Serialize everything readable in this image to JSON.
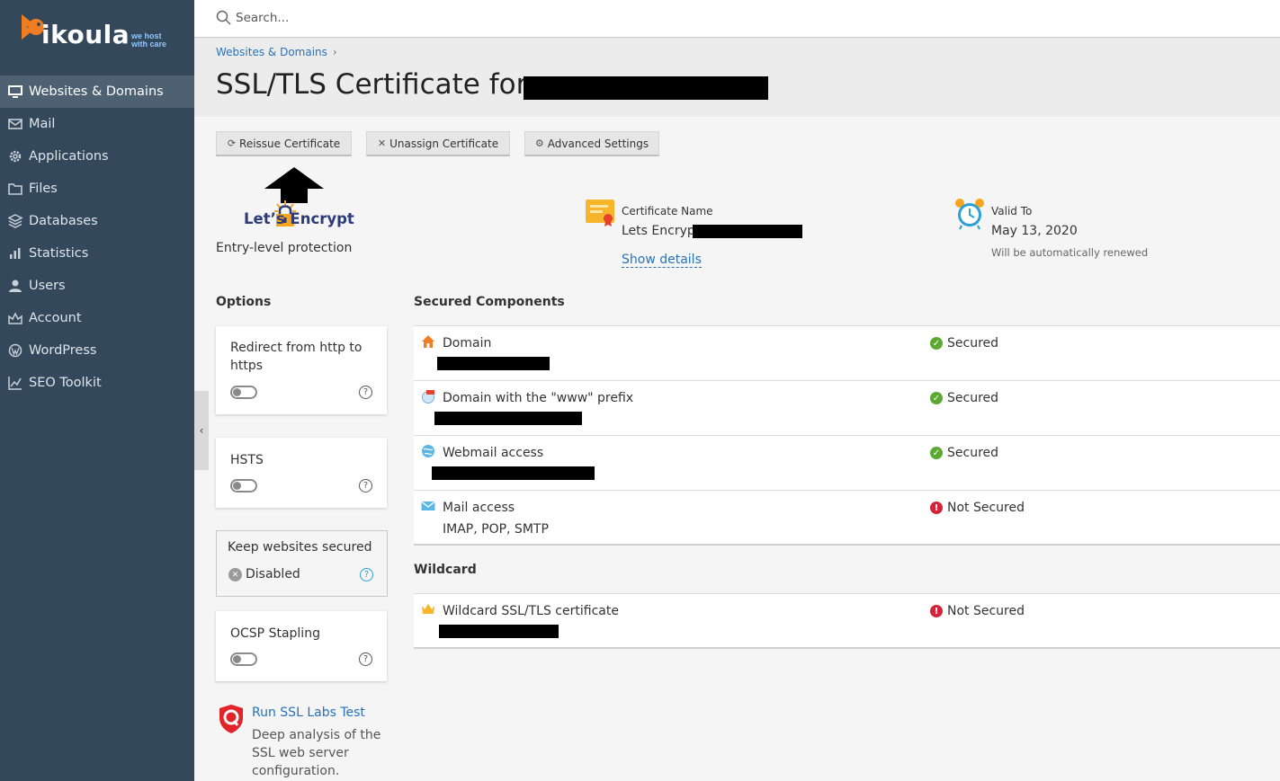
{
  "brand": {
    "name": "ikoula",
    "tagline_line1": "we host",
    "tagline_line2": "with care"
  },
  "sidebar": {
    "items": [
      {
        "label": "Websites & Domains",
        "icon": "monitor-icon",
        "active": true
      },
      {
        "label": "Mail",
        "icon": "mail-icon"
      },
      {
        "label": "Applications",
        "icon": "gear-icon"
      },
      {
        "label": "Files",
        "icon": "folder-icon"
      },
      {
        "label": "Databases",
        "icon": "database-icon"
      },
      {
        "label": "Statistics",
        "icon": "bar-chart-icon"
      },
      {
        "label": "Users",
        "icon": "user-icon"
      },
      {
        "label": "Account",
        "icon": "account-icon"
      },
      {
        "label": "WordPress",
        "icon": "wordpress-icon"
      },
      {
        "label": "SEO Toolkit",
        "icon": "seo-chart-icon"
      }
    ]
  },
  "search": {
    "placeholder": "Search..."
  },
  "header": {
    "breadcrumb": "Websites & Domains",
    "breadcrumb_sep": "›",
    "title": "SSL/TLS Certificate for"
  },
  "toolbar": {
    "reissue_label": "Reissue Certificate",
    "unassign_label": "Unassign Certificate",
    "advanced_label": "Advanced Settings"
  },
  "provider": {
    "name": "Let’s Encrypt",
    "level": "Entry-level protection"
  },
  "certificate": {
    "label": "Certificate Name",
    "name": "Lets Encrypt",
    "details_link": "Show details"
  },
  "validity": {
    "label": "Valid To",
    "date": "May 13, 2020",
    "note": "Will be automatically renewed"
  },
  "options": {
    "title": "Options",
    "redirect_label": "Redirect from http to https",
    "hsts_label": "HSTS",
    "keep_secured_label": "Keep websites secured",
    "keep_secured_status": "Disabled",
    "ocsp_label": "OCSP Stapling",
    "help_glyph": "?"
  },
  "ssl_labs": {
    "link": "Run SSL Labs Test",
    "description": "Deep analysis of the SSL web server configuration."
  },
  "secured_components": {
    "title": "Secured Components",
    "rows": [
      {
        "label": "Domain",
        "icon": "home-icon",
        "status": "Secured"
      },
      {
        "label": "Domain with the \"www\" prefix",
        "icon": "www-globe-icon",
        "status": "Secured"
      },
      {
        "label": "Webmail access",
        "icon": "webmail-globe-icon",
        "status": "Secured"
      },
      {
        "label": "Mail access",
        "sub": "IMAP, POP, SMTP",
        "icon": "envelope-icon",
        "status": "Not Secured"
      }
    ]
  },
  "wildcard": {
    "title": "Wildcard",
    "rows": [
      {
        "label": "Wildcard SSL/TLS certificate",
        "icon": "crown-icon",
        "status": "Not Secured"
      }
    ]
  },
  "status_glyphs": {
    "ok": "✓",
    "bad": "!"
  },
  "colors": {
    "sidebar_bg": "#34485c",
    "accent_link": "#2a72b8",
    "secured_green": "#5ba832",
    "not_secured_red": "#d3243c"
  }
}
